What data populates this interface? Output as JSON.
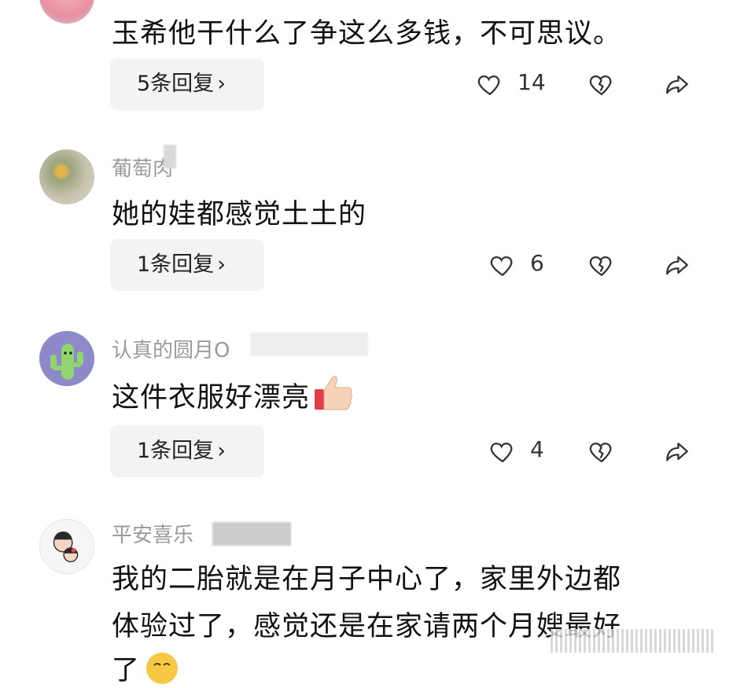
{
  "comments": [
    {
      "username": "",
      "text": "玉希他干什么了争这么多钱，不可思议。",
      "reply_label": "5条回复",
      "likes": "14"
    },
    {
      "username": "葡萄肉",
      "text": "她的娃都感觉土土的",
      "reply_label": "1条回复",
      "likes": "6"
    },
    {
      "username": "认真的圆月O",
      "text": "这件衣服好漂亮",
      "reply_label": "1条回复",
      "likes": "4"
    },
    {
      "username": "平安喜乐",
      "text_line1": "我的二胎就是在月子中心了，家里外边都",
      "text_line2": "体验过了，感觉还是在家请两个月嫂最好",
      "text_line3": "了"
    }
  ],
  "icons": {
    "like": "heart-outline-icon",
    "dislike": "broken-heart-icon",
    "share": "share-arrow-icon",
    "thumb": "thumbs-up-emoji",
    "grin": "smile-emoji"
  },
  "chevron": "›"
}
